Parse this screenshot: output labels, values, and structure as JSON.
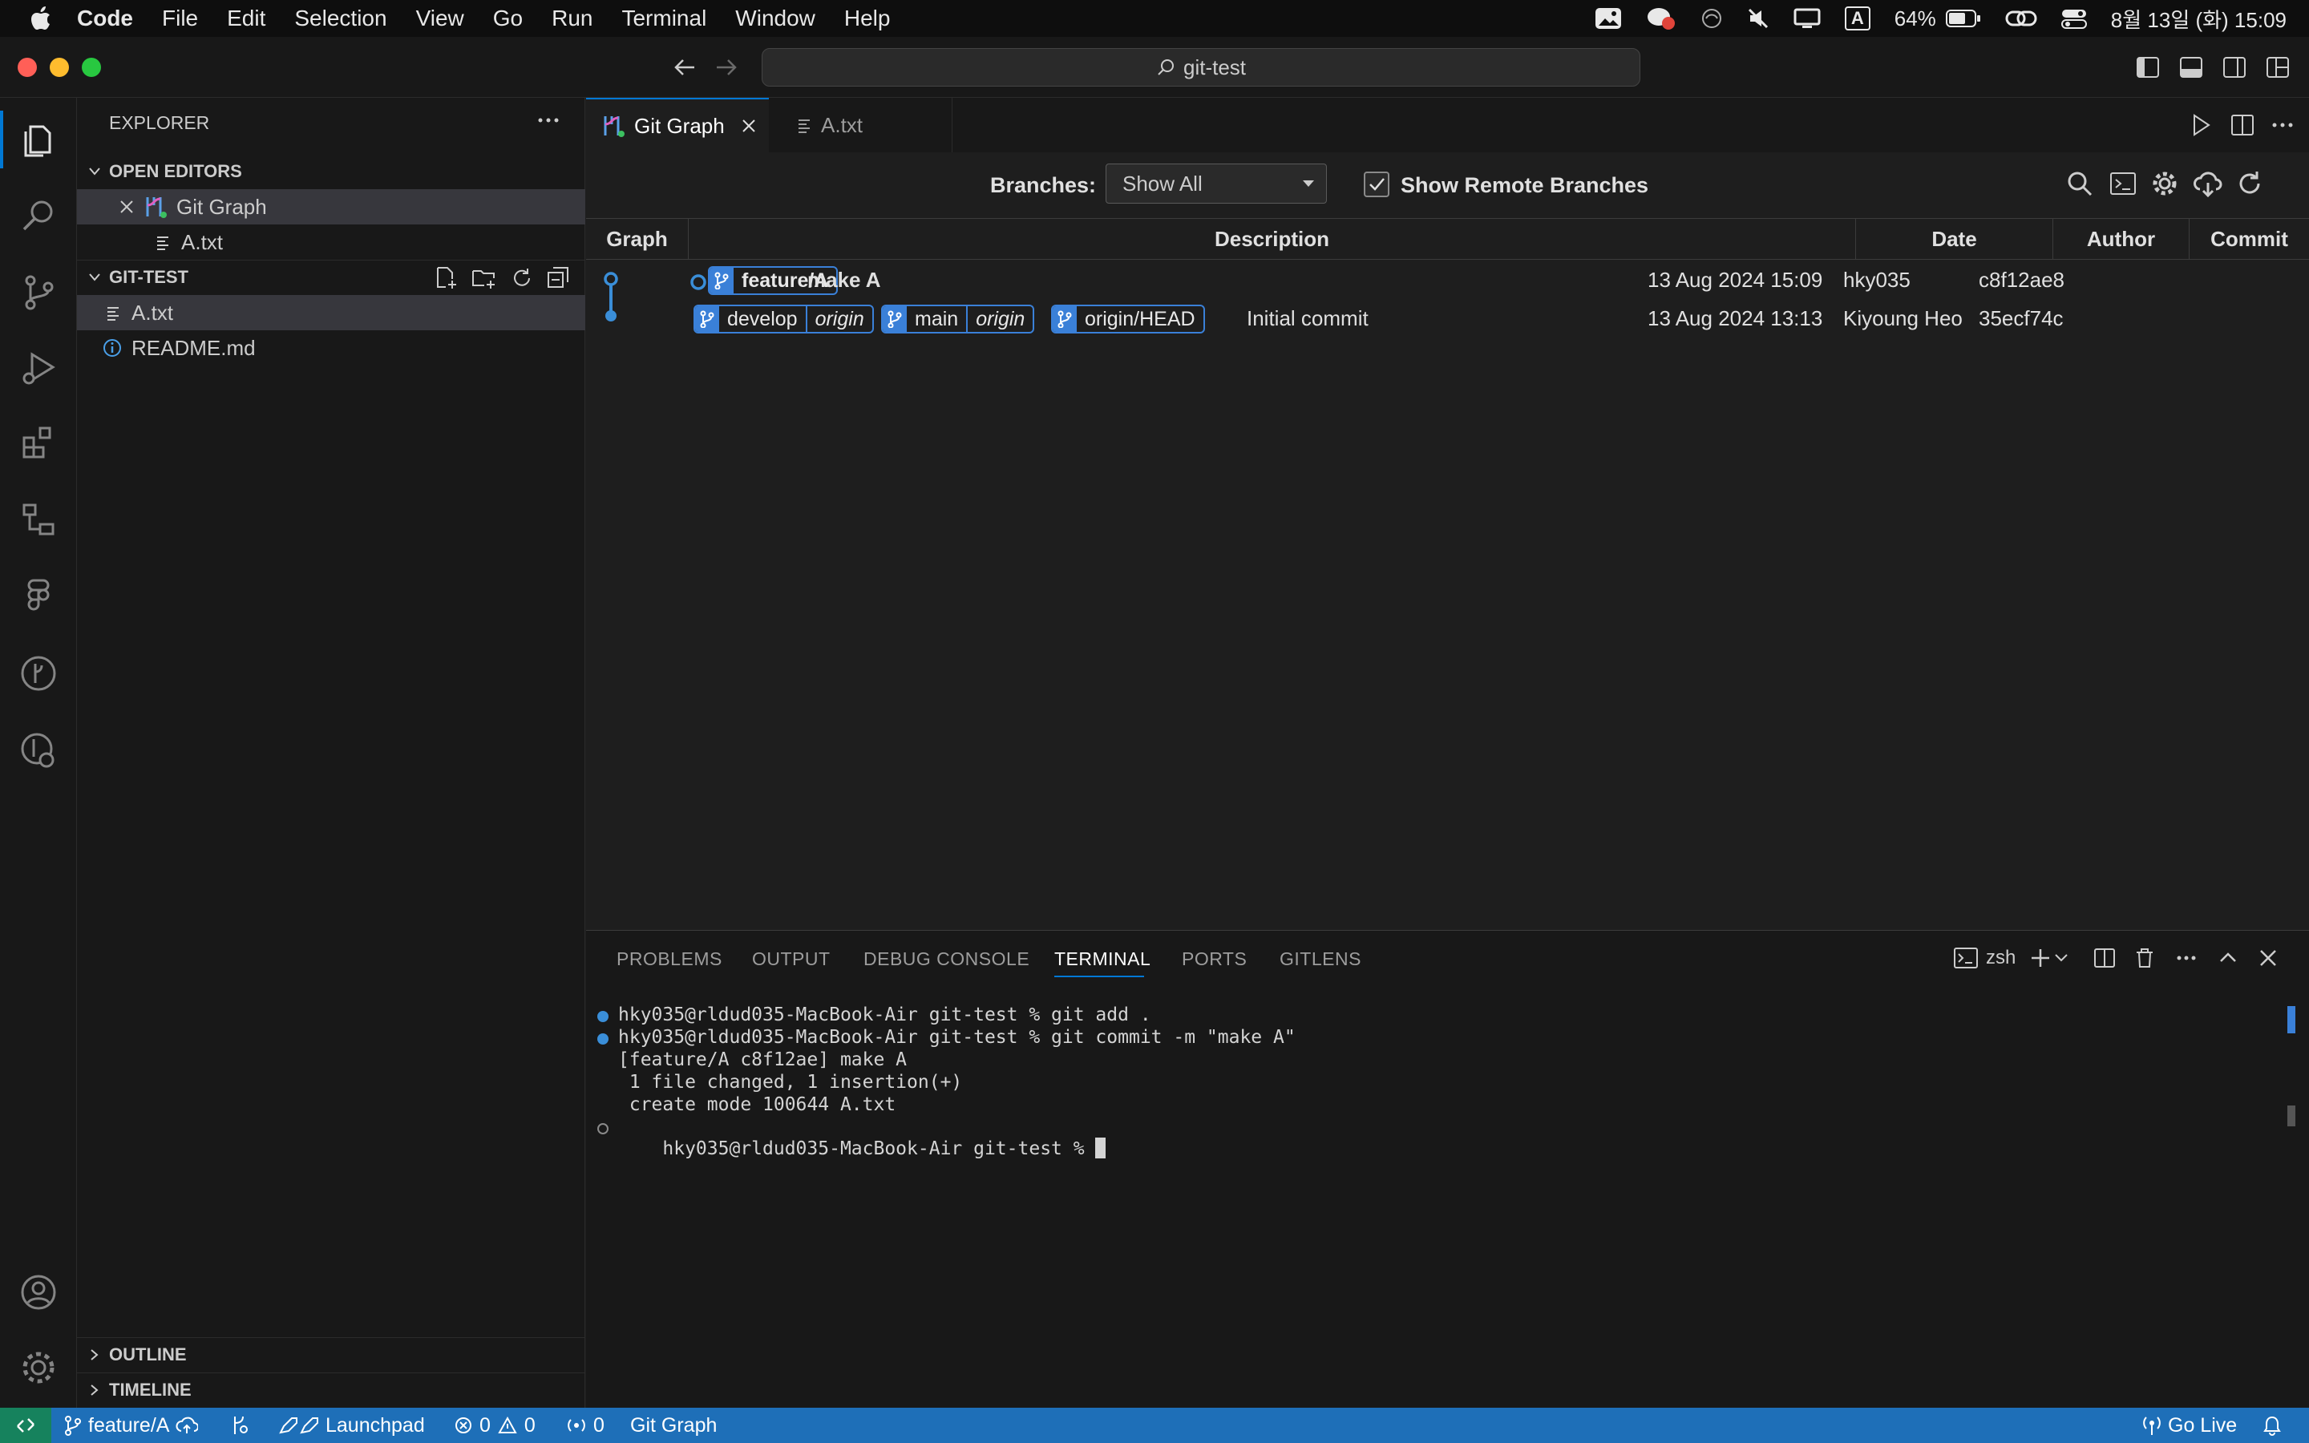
{
  "menubar": {
    "app": "Code",
    "items": [
      "File",
      "Edit",
      "Selection",
      "View",
      "Go",
      "Run",
      "Terminal",
      "Window",
      "Help"
    ],
    "battery": "64%",
    "input_indicator": "A",
    "datetime": "8월 13일 (화) 15:09"
  },
  "titlebar": {
    "search": "git-test"
  },
  "explorer": {
    "title": "EXPLORER",
    "open_editors_label": "OPEN EDITORS",
    "open_editors": [
      "Git Graph",
      "A.txt"
    ],
    "workspace_label": "GIT-TEST",
    "files": [
      "A.txt",
      "README.md"
    ],
    "outline_label": "OUTLINE",
    "timeline_label": "TIMELINE"
  },
  "tabs": [
    {
      "label": "Git Graph",
      "active": true
    },
    {
      "label": "A.txt",
      "active": false
    }
  ],
  "git_graph": {
    "branches_label": "Branches:",
    "branches_value": "Show All",
    "show_remote_label": "Show Remote Branches",
    "show_remote_checked": true,
    "columns": [
      "Graph",
      "Description",
      "Date",
      "Author",
      "Commit"
    ],
    "commits": [
      {
        "refs": [
          {
            "name": "feature/A",
            "remote": ""
          }
        ],
        "message": "make A",
        "date": "13 Aug 2024 15:09",
        "author": "hky035",
        "hash": "c8f12ae8"
      },
      {
        "refs": [
          {
            "name": "develop",
            "remote": "origin"
          },
          {
            "name": "main",
            "remote": "origin"
          },
          {
            "name": "origin/HEAD",
            "remote": ""
          }
        ],
        "message": "Initial commit",
        "date": "13 Aug 2024 13:13",
        "author": "Kiyoung Heo",
        "hash": "35ecf74c"
      }
    ]
  },
  "panel": {
    "tabs": [
      "PROBLEMS",
      "OUTPUT",
      "DEBUG CONSOLE",
      "TERMINAL",
      "PORTS",
      "GITLENS"
    ],
    "active_tab": "TERMINAL",
    "shell": "zsh",
    "lines": [
      "hky035@rldud035-MacBook-Air git-test % git add .",
      "hky035@rldud035-MacBook-Air git-test % git commit -m \"make A\"",
      "[feature/A c8f12ae] make A",
      " 1 file changed, 1 insertion(+)",
      " create mode 100644 A.txt",
      "hky035@rldud035-MacBook-Air git-test % "
    ]
  },
  "statusbar": {
    "branch": "feature/A",
    "launchpad": "Launchpad",
    "errors": "0",
    "warnings": "0",
    "ports": "0",
    "git_graph": "Git Graph",
    "go_live": "Go Live"
  },
  "colors": {
    "accent": "#1e6fb8",
    "ref_blue": "#3a80d8",
    "graph_line": "#3a8ed8"
  }
}
